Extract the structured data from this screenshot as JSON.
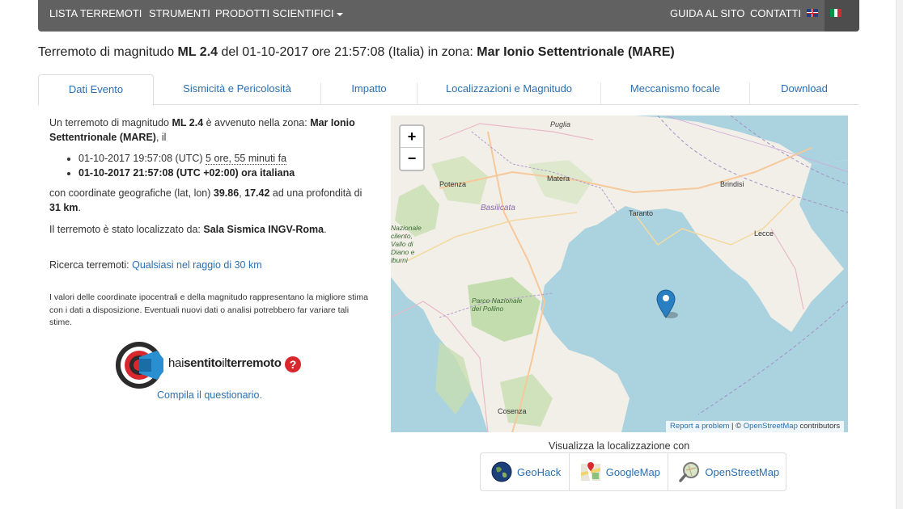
{
  "navbar": {
    "lista_terremoti": "LISTA TERREMOTI",
    "strumenti": "STRUMENTI",
    "prodotti_scientifici": "PRODOTTI SCIENTIFICI",
    "guida": "GUIDA AL SITO",
    "contatti": "CONTATTI"
  },
  "title": {
    "prefix": "Terremoto di magnitudo ",
    "magnitude": "ML 2.4",
    "middle": " del 01-10-2017 ore 21:57:08 (Italia) in zona: ",
    "zone": "Mar Ionio Settentrionale (MARE)"
  },
  "tabs": [
    {
      "label": "Dati Evento"
    },
    {
      "label": "Sismicità e Pericolosità"
    },
    {
      "label": "Impatto"
    },
    {
      "label": "Localizzazioni e Magnitudo"
    },
    {
      "label": "Meccanismo focale"
    },
    {
      "label": "Download"
    }
  ],
  "event": {
    "intro_a": "Un terremoto di magnitudo ",
    "magnitude": "ML 2.4",
    "intro_b": " è avvenuto nella zona: ",
    "zone": "Mar Ionio Settentrionale (MARE)",
    "intro_c": ", il",
    "utc_time": "01-10-2017 19:57:08 (UTC)",
    "ago": "5 ore, 55 minuti fa",
    "local_time": "01-10-2017 21:57:08 (UTC +02:00) ora italiana",
    "coord_a": "con coordinate geografiche (lat, lon) ",
    "lat": "39.86",
    "sep": ", ",
    "lon": "17.42",
    "coord_b": " ad una profondità di ",
    "depth": "31 km",
    "coord_c": ".",
    "located_a": "Il terremoto è stato localizzato da: ",
    "located_by": "Sala Sismica INGV-Roma",
    "located_c": ".",
    "search_label": "Ricerca terremoti: ",
    "search_link": "Qualsiasi nel raggio di 30 km",
    "note": "I valori delle coordinate ipocentrali e della magnitudo rappresentano la migliore stima con i dati a disposizione. Eventuali nuovi dati o analisi potrebbero far variare tali stime."
  },
  "hst": {
    "text_a": "hai",
    "text_b": "sentito",
    "text_c": "il",
    "text_d": "terremoto",
    "question": "?",
    "compila": "Compila il questionario."
  },
  "map": {
    "zoom_in": "+",
    "zoom_out": "−",
    "labels": {
      "puglia": "Puglia",
      "potenza": "Potenza",
      "matera": "Matera",
      "brindisi": "Brindisi",
      "basilicata": "Basilicata",
      "taranto": "Taranto",
      "lecce": "Lecce",
      "park_west": "Nazionale\ncilento,\nVallo di\nDiano e\nlburni",
      "pollino": "Parco Nazionale\ndel Pollino",
      "cosenza": "Cosenza"
    },
    "attribution_link1": "Report a problem",
    "attribution_sep": " | © ",
    "attribution_link2": "OpenStreetMap",
    "attribution_tail": " contributors"
  },
  "view": {
    "label": "Visualizza la localizzazione con",
    "buttons": [
      {
        "label": "GeoHack",
        "icon": "globe-icon"
      },
      {
        "label": "GoogleMap",
        "icon": "google-maps-icon"
      },
      {
        "label": "OpenStreetMap",
        "icon": "magnifier-map-icon"
      }
    ]
  },
  "colors": {
    "navbar": "#616161",
    "link": "#2a6fb1",
    "sea": "#aad3df",
    "land": "#f2efe9",
    "marker": "#2a7fc2",
    "hst_red": "#d8282e"
  }
}
